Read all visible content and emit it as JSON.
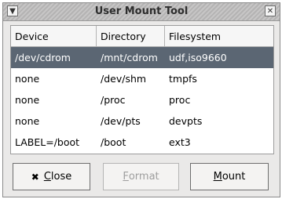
{
  "window": {
    "title": "User Mount Tool",
    "menu_icon": "chevron-down-icon",
    "close_icon": "close-icon"
  },
  "table": {
    "headers": [
      "Device",
      "Directory",
      "Filesystem"
    ],
    "rows": [
      [
        "/dev/cdrom",
        "/mnt/cdrom",
        "udf,iso9660"
      ],
      [
        "none",
        "/dev/shm",
        "tmpfs"
      ],
      [
        "none",
        "/proc",
        "proc"
      ],
      [
        "none",
        "/dev/pts",
        "devpts"
      ],
      [
        "LABEL=/boot",
        "/boot",
        "ext3"
      ]
    ],
    "selected_row": 0
  },
  "buttons": {
    "close": {
      "mnemonic": "C",
      "rest": "lose",
      "icon": "close-x-icon"
    },
    "format": {
      "mnemonic": "F",
      "rest": "ormat",
      "enabled": false
    },
    "mount": {
      "mnemonic": "M",
      "rest": "ount"
    }
  },
  "colors": {
    "selection_bg": "#5b6673",
    "disabled_text": "#9e9e9e"
  }
}
